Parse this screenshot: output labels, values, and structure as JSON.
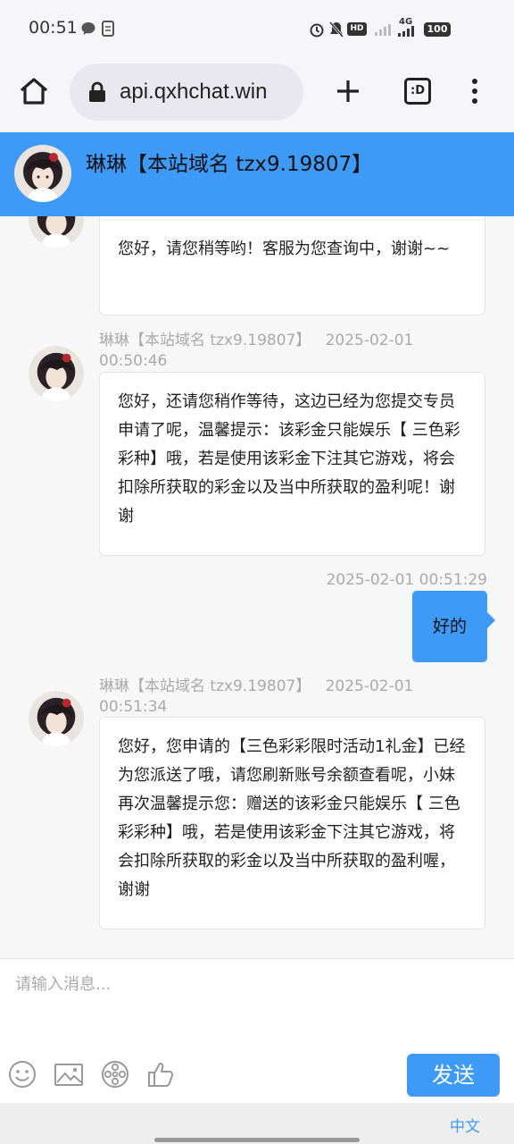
{
  "status_bar": {
    "time": "00:51",
    "battery": "100",
    "network": "4G"
  },
  "browser": {
    "url": "api.qxhchat.win",
    "tabs_label": ":D"
  },
  "chat_header": {
    "title": "琳琳【本站域名 tzx9.19807】"
  },
  "messages": [
    {
      "text": "您好，请您稍等哟！客服为您查询中，谢谢~~"
    },
    {
      "sender": "琳琳【本站域名 tzx9.19807】",
      "time": "2025-02-01 00:50:46",
      "text": "您好，还请您稍作等待，这边已经为您提交专员申请了呢，温馨提示：该彩金只能娱乐【 三色彩彩种】哦，若是使用该彩金下注其它游戏，将会扣除所获取的彩金以及当中所获取的盈利呢！谢谢"
    },
    {
      "time": "2025-02-01 00:51:29",
      "text": "好的"
    },
    {
      "sender": "琳琳【本站域名 tzx9.19807】",
      "time": "2025-02-01 00:51:34",
      "text": "您好，您申请的【三色彩彩限时活动1礼金】已经为您派送了哦，请您刷新账号余额查看呢，小妹再次温馨提示您：赠送的该彩金只能娱乐【 三色彩彩种】哦，若是使用该彩金下注其它游戏，将会扣除所获取的彩金以及当中所获取的盈利喔，谢谢"
    }
  ],
  "input": {
    "placeholder": "请输入消息..."
  },
  "send_label": "发送",
  "language_label": "中文",
  "colors": {
    "accent": "#3d9af7",
    "bubble_bg": "#ffffff",
    "meta_text": "#aaaaaa"
  },
  "icons": [
    "emoji-icon",
    "image-icon",
    "video-icon",
    "thumbs-up-icon"
  ]
}
